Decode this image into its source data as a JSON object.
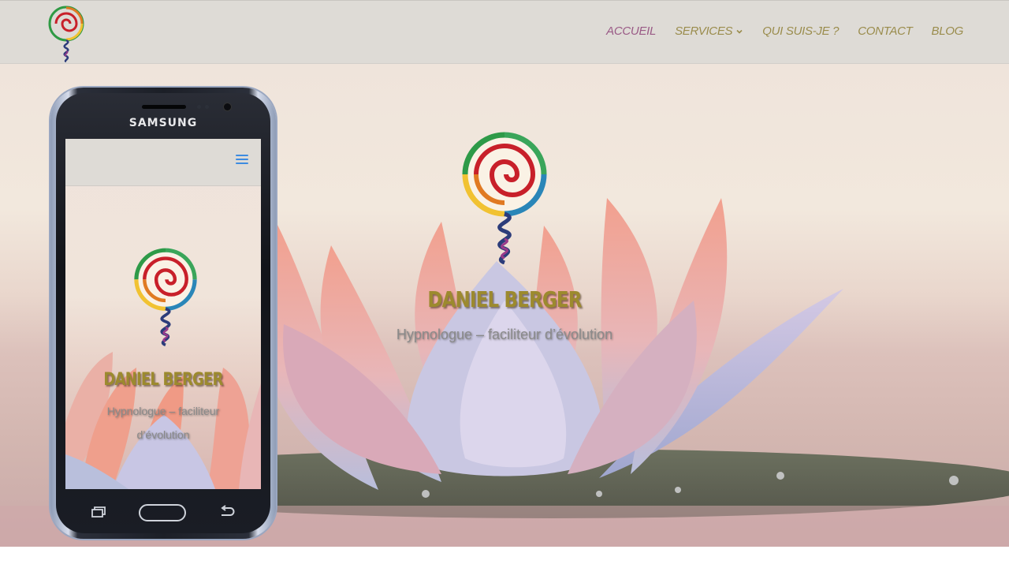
{
  "header": {
    "logo_icon": "spiral-logo-icon",
    "nav": [
      {
        "label": "ACCUEIL",
        "active": true
      },
      {
        "label": "SERVICES",
        "has_dropdown": true
      },
      {
        "label": "QUI SUIS-JE ?"
      },
      {
        "label": "CONTACT"
      },
      {
        "label": "BLOG"
      }
    ]
  },
  "hero": {
    "title": "DANIEL BERGER",
    "subtitle": "Hypnologue – faciliteur d’évolution",
    "background": "pink-lotus-image"
  },
  "phone": {
    "brand": "SAMSUNG",
    "screen": {
      "menu_icon": "hamburger-menu-icon",
      "title": "DANIEL BERGER",
      "subtitle": "Hypnologue – faciliteur d’évolution"
    }
  },
  "colors": {
    "nav_text": "#9a8c4c",
    "nav_active": "#9a5a86",
    "title": "#9c8a2e",
    "header_bg": "#dedbd6"
  }
}
